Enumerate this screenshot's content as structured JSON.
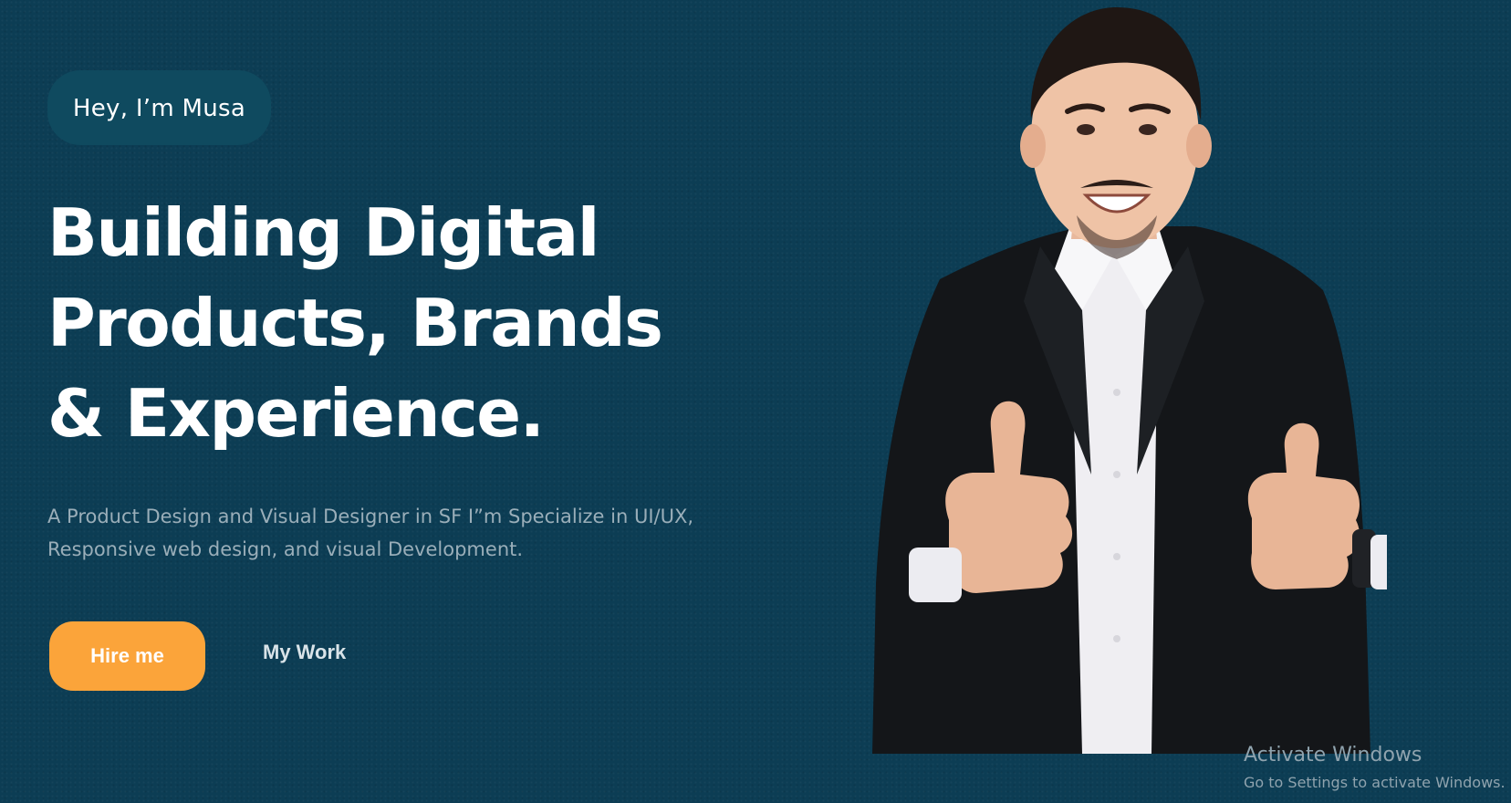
{
  "hero": {
    "greeting": "Hey, I’m Musa",
    "headline_lines": [
      "Building Digital",
      "Products, Brands",
      "& Experience."
    ],
    "intro_line_1": "A Product Design and Visual Designer in SF I”m Specialize in UI/UX,",
    "intro_line_2": "Responsive web design, and visual Development.",
    "primary_button": "Hire me",
    "secondary_link": "My Work",
    "portrait_icon": "person-portrait-thumbs-up"
  },
  "system_overlay": {
    "title": "Activate Windows",
    "subtitle": "Go to Settings to activate Windows."
  },
  "colors": {
    "background": "#0c3d54",
    "pill": "#0f4a5f",
    "accent": "#fba43a",
    "muted_text": "#9aaeb9"
  }
}
